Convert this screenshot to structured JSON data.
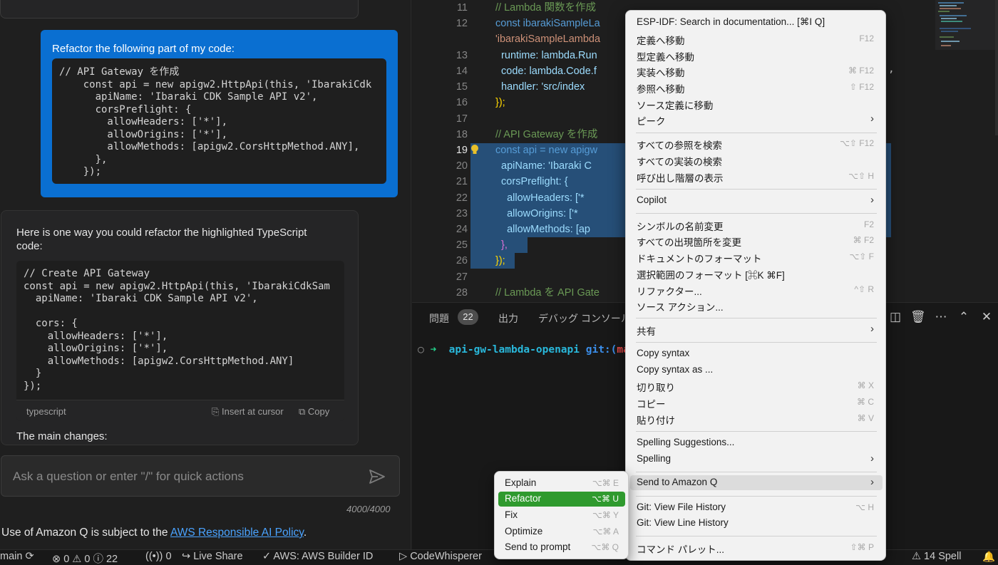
{
  "chat": {
    "user_label": "Refactor the following part of my code:",
    "user_code": "// API Gateway を作成\n    const api = new apigw2.HttpApi(this, 'IbarakiCdk\n      apiName: 'Ibaraki CDK Sample API v2',\n      corsPreflight: {\n        allowHeaders: ['*'],\n        allowOrigins: ['*'],\n        allowMethods: [apigw2.CorsHttpMethod.ANY],\n      },\n    });",
    "ai_intro": "Here is one way you could refactor the highlighted TypeScript code:",
    "ai_code": "// Create API Gateway\nconst api = new apigw2.HttpApi(this, 'IbarakiCdkSam\n  apiName: 'Ibaraki CDK Sample API v2',\n\n  cors: {\n    allowHeaders: ['*'],\n    allowOrigins: ['*'],\n    allowMethods: [apigw2.CorsHttpMethod.ANY]\n  }\n});",
    "code_lang": "typescript",
    "insert_label": "Insert at cursor",
    "copy_label": "Copy",
    "changes_heading": "The main changes:",
    "prompt_placeholder": "Ask a question or enter \"/\" for quick actions",
    "counter": "4000/4000",
    "policy_text": "Use of Amazon Q is subject to the ",
    "policy_link": "AWS Responsible AI Policy",
    "policy_end": "."
  },
  "editor": {
    "lines": [
      {
        "n": "11",
        "text": "// Lambda 関数を作成"
      },
      {
        "n": "12",
        "text": "const ibarakiSampleLa"
      },
      {
        "n": "",
        "text": "'ibarakiSampleLambda"
      },
      {
        "n": "13",
        "text": "  runtime: lambda.Run"
      },
      {
        "n": "14",
        "text": "  code: lambda.Code.f"
      },
      {
        "n": "15",
        "text": "  handler: 'src/index"
      },
      {
        "n": "16",
        "text": "});"
      },
      {
        "n": "17",
        "text": ""
      },
      {
        "n": "18",
        "text": "// API Gateway を作成"
      },
      {
        "n": "19",
        "text": "const api = new apigw"
      },
      {
        "n": "20",
        "text": "  apiName: 'Ibaraki C"
      },
      {
        "n": "21",
        "text": "  corsPreflight: {"
      },
      {
        "n": "22",
        "text": "    allowHeaders: ['*"
      },
      {
        "n": "23",
        "text": "    allowOrigins: ['*"
      },
      {
        "n": "24",
        "text": "    allowMethods: [ap"
      },
      {
        "n": "25",
        "text": "  },"
      },
      {
        "n": "26",
        "text": "});"
      },
      {
        "n": "27",
        "text": ""
      },
      {
        "n": "28",
        "text": "// Lambda を API Gate"
      }
    ],
    "right_edge_text": ","
  },
  "panel": {
    "tabs": [
      "問題",
      "出力",
      "デバッグ コンソール"
    ],
    "problems_count": "22",
    "terminal_dir": "api-gw-lambda-openapi",
    "terminal_git": "git:(",
    "terminal_branch": "ma"
  },
  "context_menu": {
    "items": [
      {
        "label": "ESP-IDF: Search in documentation... [⌘I Q]",
        "key": "",
        "sub": false
      },
      {
        "label": "定義へ移動",
        "key": "F12",
        "sub": false
      },
      {
        "label": "型定義へ移動",
        "key": "",
        "sub": false
      },
      {
        "label": "実装へ移動",
        "key": "⌘ F12",
        "sub": false
      },
      {
        "label": "参照へ移動",
        "key": "⇧ F12",
        "sub": false
      },
      {
        "label": "ソース定義に移動",
        "key": "",
        "sub": false
      },
      {
        "label": "ピーク",
        "key": "",
        "sub": true
      },
      {
        "label": "すべての参照を検索",
        "key": "⌥⇧ F12",
        "sub": false
      },
      {
        "label": "すべての実装の検索",
        "key": "",
        "sub": false
      },
      {
        "label": "呼び出し階層の表示",
        "key": "⌥⇧ H",
        "sub": false
      },
      {
        "label": "Copilot",
        "key": "",
        "sub": true
      },
      {
        "label": "シンボルの名前変更",
        "key": "F2",
        "sub": false
      },
      {
        "label": "すべての出現箇所を変更",
        "key": "⌘ F2",
        "sub": false
      },
      {
        "label": "ドキュメントのフォーマット",
        "key": "⌥⇧ F",
        "sub": false
      },
      {
        "label": "選択範囲のフォーマット [⌘K ⌘F]",
        "key": "",
        "sub": false
      },
      {
        "label": "リファクター...",
        "key": "^⇧ R",
        "sub": false
      },
      {
        "label": "ソース アクション...",
        "key": "",
        "sub": false
      },
      {
        "label": "共有",
        "key": "",
        "sub": true
      },
      {
        "label": "Copy syntax",
        "key": "",
        "sub": false
      },
      {
        "label": "Copy syntax as ...",
        "key": "",
        "sub": false
      },
      {
        "label": "切り取り",
        "key": "⌘ X",
        "sub": false
      },
      {
        "label": "コピー",
        "key": "⌘ C",
        "sub": false
      },
      {
        "label": "貼り付け",
        "key": "⌘ V",
        "sub": false
      },
      {
        "label": "Spelling Suggestions...",
        "key": "",
        "sub": false
      },
      {
        "label": "Spelling",
        "key": "",
        "sub": true
      },
      {
        "label": "Send to Amazon Q",
        "key": "",
        "sub": true
      },
      {
        "label": "Git: View File History",
        "key": "⌥ H",
        "sub": false
      },
      {
        "label": "Git: View Line History",
        "key": "",
        "sub": false
      },
      {
        "label": "コマンド パレット...",
        "key": "⇧⌘ P",
        "sub": false
      }
    ]
  },
  "submenu": {
    "items": [
      {
        "label": "Explain",
        "key": "⌥⌘ E"
      },
      {
        "label": "Refactor",
        "key": "⌥⌘ U"
      },
      {
        "label": "Fix",
        "key": "⌥⌘ Y"
      },
      {
        "label": "Optimize",
        "key": "⌥⌘ A"
      },
      {
        "label": "Send to prompt",
        "key": "⌥⌘ Q"
      }
    ]
  },
  "status": {
    "branch": "main",
    "errors": "0",
    "warnings": "0",
    "infos": "22",
    "ports": "0",
    "live_share": "Live Share",
    "aws": "AWS: AWS Builder ID",
    "codewhisperer": "CodeWhisperer",
    "spell": "14 Spell"
  },
  "colors": {
    "accent": "#0a6fd1",
    "submenu_active": "#2f9a2e",
    "selection": "#264f78"
  }
}
